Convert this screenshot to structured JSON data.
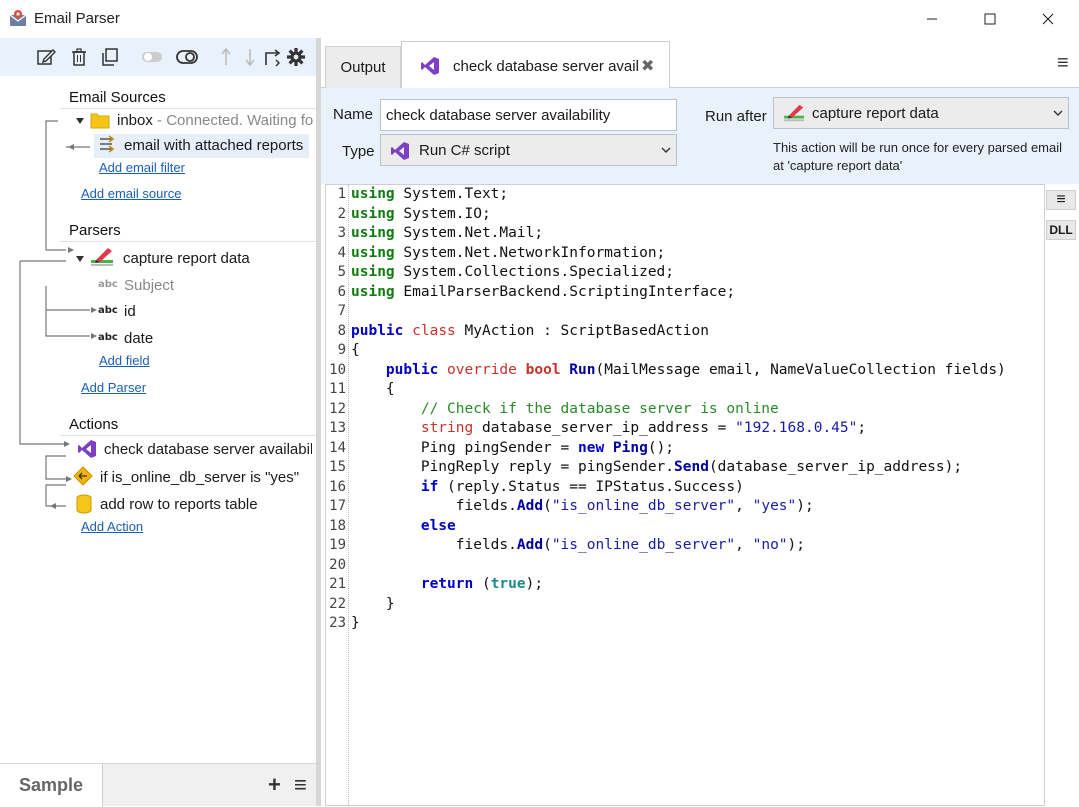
{
  "window": {
    "title": "Email Parser"
  },
  "tree": {
    "email_sources_head": "Email Sources",
    "inbox_label": "inbox",
    "inbox_status": " - Connected. Waiting fo",
    "filter_label": "email with attached reports",
    "add_email_filter": "Add email filter",
    "add_email_source": "Add email source",
    "parsers_head": "Parsers",
    "parser_label": "capture report data",
    "fields": [
      "Subject",
      "id",
      "date"
    ],
    "abc_label": "abc",
    "add_field": "Add field",
    "add_parser": "Add Parser",
    "actions_head": "Actions",
    "actions": [
      "check database server availabili",
      "if is_online_db_server is \"yes\"",
      "add row to reports table"
    ],
    "add_action": "Add Action"
  },
  "bottom": {
    "sample_tab": "Sample",
    "add_symbol": "+",
    "menu_symbol": "≡"
  },
  "tabs": {
    "output": "Output",
    "active": "check database server avail",
    "close_symbol": "✖",
    "menu_symbol": "≡"
  },
  "props": {
    "name_label": "Name",
    "name_value": "check database server availability",
    "type_label": "Type",
    "type_value": "Run C# script",
    "run_after_label": "Run after",
    "run_after_value": "capture report data",
    "hint": "This action will be run once for every parsed email at 'capture report data'"
  },
  "editor": {
    "side_menu": "≡",
    "dll_label": "DLL",
    "line_numbers": [
      "1",
      "2",
      "3",
      "4",
      "5",
      "6",
      "7",
      "8",
      "9",
      "10",
      "11",
      "12",
      "13",
      "14",
      "15",
      "16",
      "17",
      "18",
      "19",
      "20",
      "21",
      "22",
      "23"
    ],
    "lines": [
      [
        [
          "kw-g",
          "using"
        ],
        [
          "",
          "System.Text;"
        ]
      ],
      [
        [
          "kw-g",
          "using"
        ],
        [
          "",
          "System.IO;"
        ]
      ],
      [
        [
          "kw-g",
          "using"
        ],
        [
          "",
          "System.Net.Mail;"
        ]
      ],
      [
        [
          "kw-g",
          "using"
        ],
        [
          "",
          "System.Net.NetworkInformation;"
        ]
      ],
      [
        [
          "kw-g",
          "using"
        ],
        [
          "",
          "System.Collections.Specialized;"
        ]
      ],
      [
        [
          "kw-g",
          "using"
        ],
        [
          "",
          "EmailParserBackend.ScriptingInterface;"
        ]
      ],
      [],
      [
        [
          "kw-b",
          "public"
        ],
        [
          "",
          "space"
        ],
        [
          "kw-r",
          "class"
        ],
        [
          "",
          "MyAction : ScriptBasedAction"
        ]
      ],
      [
        [
          "",
          "{"
        ]
      ],
      [
        [
          "",
          "indent4"
        ],
        [
          "kw-b",
          "public"
        ],
        [
          "",
          "space"
        ],
        [
          "kw-r",
          "override"
        ],
        [
          "",
          "space"
        ],
        [
          "kw-rb",
          "bool"
        ],
        [
          "",
          "space"
        ],
        [
          "fn",
          "Run"
        ],
        [
          "",
          "(MailMessage email, NameValueCollection fields)"
        ]
      ],
      [
        [
          "",
          "indent4"
        ],
        [
          "",
          "{"
        ]
      ],
      [
        [
          "",
          "indent8"
        ],
        [
          "cmt",
          "// Check if the database server is online"
        ]
      ],
      [
        [
          "",
          "indent8"
        ],
        [
          "kw-r",
          "string"
        ],
        [
          "",
          "database_server_ip_address = "
        ],
        [
          "str",
          "\"192.168.0.45\""
        ],
        [
          "",
          ";"
        ]
      ],
      [
        [
          "",
          "indent8"
        ],
        [
          "",
          "Ping pingSender = "
        ],
        [
          "kw-b",
          "new"
        ],
        [
          "",
          "space"
        ],
        [
          "fn",
          "Ping"
        ],
        [
          "",
          "();"
        ]
      ],
      [
        [
          "",
          "indent8"
        ],
        [
          "",
          "PingReply reply = pingSender."
        ],
        [
          "fn",
          "Send"
        ],
        [
          "",
          "(database_server_ip_address);"
        ]
      ],
      [
        [
          "",
          "indent8"
        ],
        [
          "kw-b",
          "if"
        ],
        [
          "",
          "(reply.Status == IPStatus.Success)"
        ]
      ],
      [
        [
          "",
          "indent12"
        ],
        [
          "",
          "fields."
        ],
        [
          "fn",
          "Add"
        ],
        [
          "",
          "("
        ],
        [
          "str",
          "\"is_online_db_server\""
        ],
        [
          "",
          ", "
        ],
        [
          "str",
          "\"yes\""
        ],
        [
          "",
          ");"
        ]
      ],
      [
        [
          "",
          "indent8"
        ],
        [
          "kw-b",
          "else"
        ]
      ],
      [
        [
          "",
          "indent12"
        ],
        [
          "",
          "fields."
        ],
        [
          "fn",
          "Add"
        ],
        [
          "",
          "("
        ],
        [
          "str",
          "\"is_online_db_server\""
        ],
        [
          "",
          ", "
        ],
        [
          "str",
          "\"no\""
        ],
        [
          "",
          ");"
        ]
      ],
      [],
      [
        [
          "",
          "indent8"
        ],
        [
          "kw-b",
          "return"
        ],
        [
          "",
          "space"
        ],
        [
          "",
          "("
        ],
        [
          "kw-t",
          "true"
        ],
        [
          "",
          ");"
        ]
      ],
      [
        [
          "",
          "indent4"
        ],
        [
          "",
          "}"
        ]
      ],
      [
        [
          "",
          "}"
        ]
      ]
    ]
  }
}
